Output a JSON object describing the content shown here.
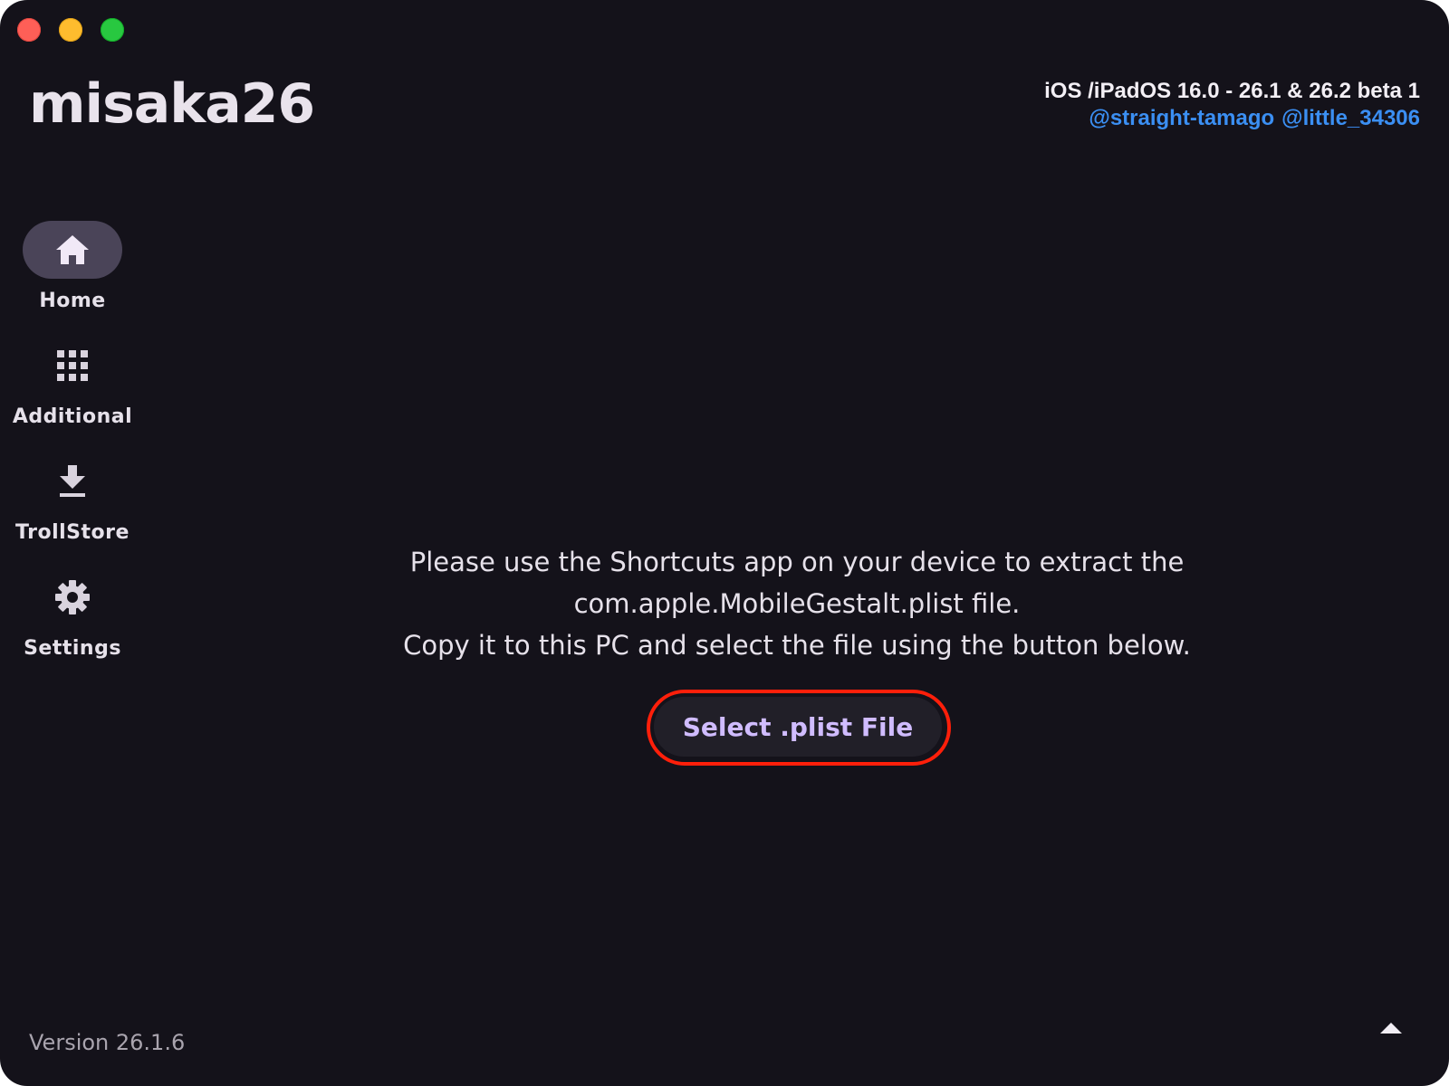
{
  "window": {
    "controls": [
      "close",
      "minimize",
      "maximize"
    ]
  },
  "header": {
    "app_title": "misaka26",
    "compatibility": "iOS /iPadOS 16.0 - 26.1 & 26.2 beta 1",
    "credits": [
      "@straight-tamago",
      "@little_34306"
    ]
  },
  "sidebar": {
    "items": [
      {
        "label": "Home",
        "icon": "home-icon",
        "active": true
      },
      {
        "label": "Additional",
        "icon": "grid-icon",
        "active": false
      },
      {
        "label": "TrollStore",
        "icon": "download-icon",
        "active": false
      },
      {
        "label": "Settings",
        "icon": "gear-icon",
        "active": false
      }
    ]
  },
  "main": {
    "instructions": [
      "Please use the Shortcuts app on your device to extract the",
      "com.apple.MobileGestalt.plist file.",
      "Copy it to this PC and select the file using the button below."
    ],
    "select_button_label": "Select .plist File"
  },
  "footer": {
    "version": "Version 26.1.6",
    "scroll_icon": "triangle-up-icon"
  },
  "colors": {
    "background": "#14121a",
    "accent": "#d0bcff",
    "active_pill": "#4a4458",
    "link": "#3b8ff3",
    "highlight": "#ff1f0a"
  }
}
